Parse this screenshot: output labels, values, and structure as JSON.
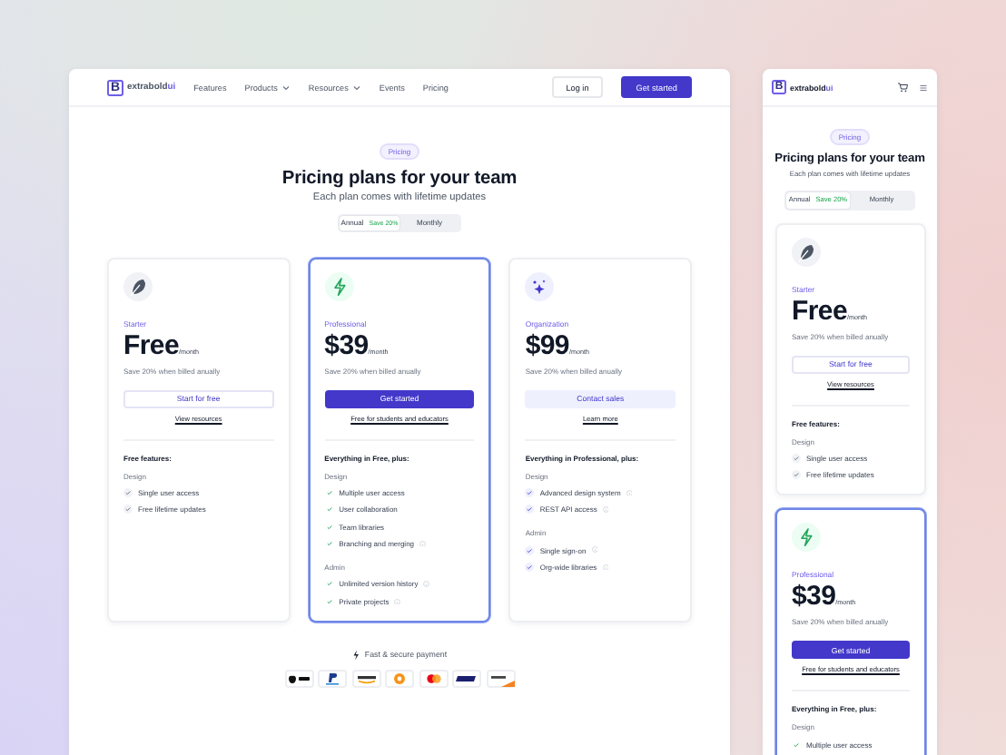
{
  "desktop": {
    "nav": {
      "logo_mark": "B",
      "logo_text": "extrabold",
      "logo_accent": "ui",
      "links": [
        {
          "label": "Features",
          "has_menu": false
        },
        {
          "label": "Products",
          "has_menu": true
        },
        {
          "label": "Resources",
          "has_menu": true
        },
        {
          "label": "Events",
          "has_menu": false
        },
        {
          "label": "Pricing",
          "has_menu": false
        }
      ],
      "login": "Log in",
      "cta": "Get started"
    },
    "hero": {
      "badge": "Pricing",
      "title": "Pricing plans for your team",
      "subtitle": "Each plan comes with lifetime updates",
      "toggle": [
        {
          "label": "Annual",
          "tag": "Save 20%",
          "selected": true
        },
        {
          "label": "Monthly",
          "selected": false
        }
      ]
    },
    "plans": [
      {
        "kind": "starter",
        "name": "Starter",
        "price": "Free",
        "unit": "/month",
        "note": "Save 20% when billed anually",
        "button": {
          "label": "Start for free"
        },
        "link": "View resources",
        "featured": false,
        "features_title": "Free features:",
        "groups": [
          {
            "title": "Design",
            "items": [
              {
                "label": "Single user access",
                "info": false
              },
              {
                "label": "Free lifetime updates",
                "info": false
              }
            ]
          }
        ]
      },
      {
        "kind": "professional",
        "name": "Professional",
        "price": "$39",
        "unit": "/month",
        "note": "Save 20% when billed anually",
        "button": {
          "label": "Get started"
        },
        "link": "Free for students and educators",
        "featured": true,
        "features_title": "Everything in Free, plus:",
        "groups": [
          {
            "title": "Design",
            "items": [
              {
                "label": "Multiple user access",
                "info": false
              },
              {
                "label": "User collaboration",
                "info": false
              },
              {
                "label": "Team libraries",
                "info": false
              },
              {
                "label": "Branching and merging",
                "info": true
              }
            ]
          },
          {
            "title": "Admin",
            "items": [
              {
                "label": "Unlimited version history",
                "info": true
              },
              {
                "label": "Private projects",
                "info": true
              }
            ]
          }
        ]
      },
      {
        "kind": "organization",
        "name": "Organization",
        "price": "$99",
        "unit": "/month",
        "note": "Save 20% when billed anually",
        "button": {
          "label": "Contact sales"
        },
        "link": "Learn more",
        "featured": false,
        "features_title": "Everything in Professional, plus:",
        "groups": [
          {
            "title": "Design",
            "items": [
              {
                "label": "Advanced design system",
                "info": true
              },
              {
                "label": "REST API access",
                "info": true
              }
            ]
          },
          {
            "title": "Admin",
            "items": [
              {
                "label": "Single sign-on",
                "info": true
              },
              {
                "label": "Org-wide libraries",
                "info": true
              }
            ]
          }
        ]
      }
    ],
    "payment": {
      "label": "Fast & secure payment",
      "methods": [
        {
          "kind": "apple-pay"
        },
        {
          "kind": "paypal"
        },
        {
          "kind": "amazon"
        },
        {
          "kind": "bitcoin"
        },
        {
          "kind": "mastercard"
        },
        {
          "kind": "visa"
        },
        {
          "kind": "discover"
        }
      ]
    }
  },
  "mobile": {
    "nav": {
      "logo_mark": "B",
      "logo_text": "extrabold",
      "logo_accent": "ui"
    },
    "hero": {
      "badge": "Pricing",
      "title": "Pricing plans for your team",
      "subtitle": "Each plan comes with lifetime updates",
      "toggle": [
        {
          "label": "Annual",
          "tag": "Save 20%",
          "selected": true
        },
        {
          "label": "Monthly",
          "selected": false
        }
      ]
    },
    "plans": [
      {
        "kind": "starter",
        "name": "Starter",
        "price": "Free",
        "unit": "/month",
        "note": "Save 20% when billed anually",
        "button": {
          "label": "Start for free"
        },
        "link": "View resources",
        "featured": false,
        "features_title": "Free features:",
        "groups": [
          {
            "title": "Design",
            "items": [
              {
                "label": "Single user access",
                "info": false
              },
              {
                "label": "Free lifetime updates",
                "info": false
              }
            ]
          }
        ]
      },
      {
        "kind": "professional",
        "name": "Professional",
        "price": "$39",
        "unit": "/month",
        "note": "Save 20% when billed anually",
        "button": {
          "label": "Get started"
        },
        "link": "Free for students and educators",
        "featured": true,
        "features_title": "Everything in Free, plus:",
        "groups": [
          {
            "title": "Design",
            "items": [
              {
                "label": "Multiple user access",
                "info": false
              }
            ]
          }
        ]
      }
    ]
  }
}
